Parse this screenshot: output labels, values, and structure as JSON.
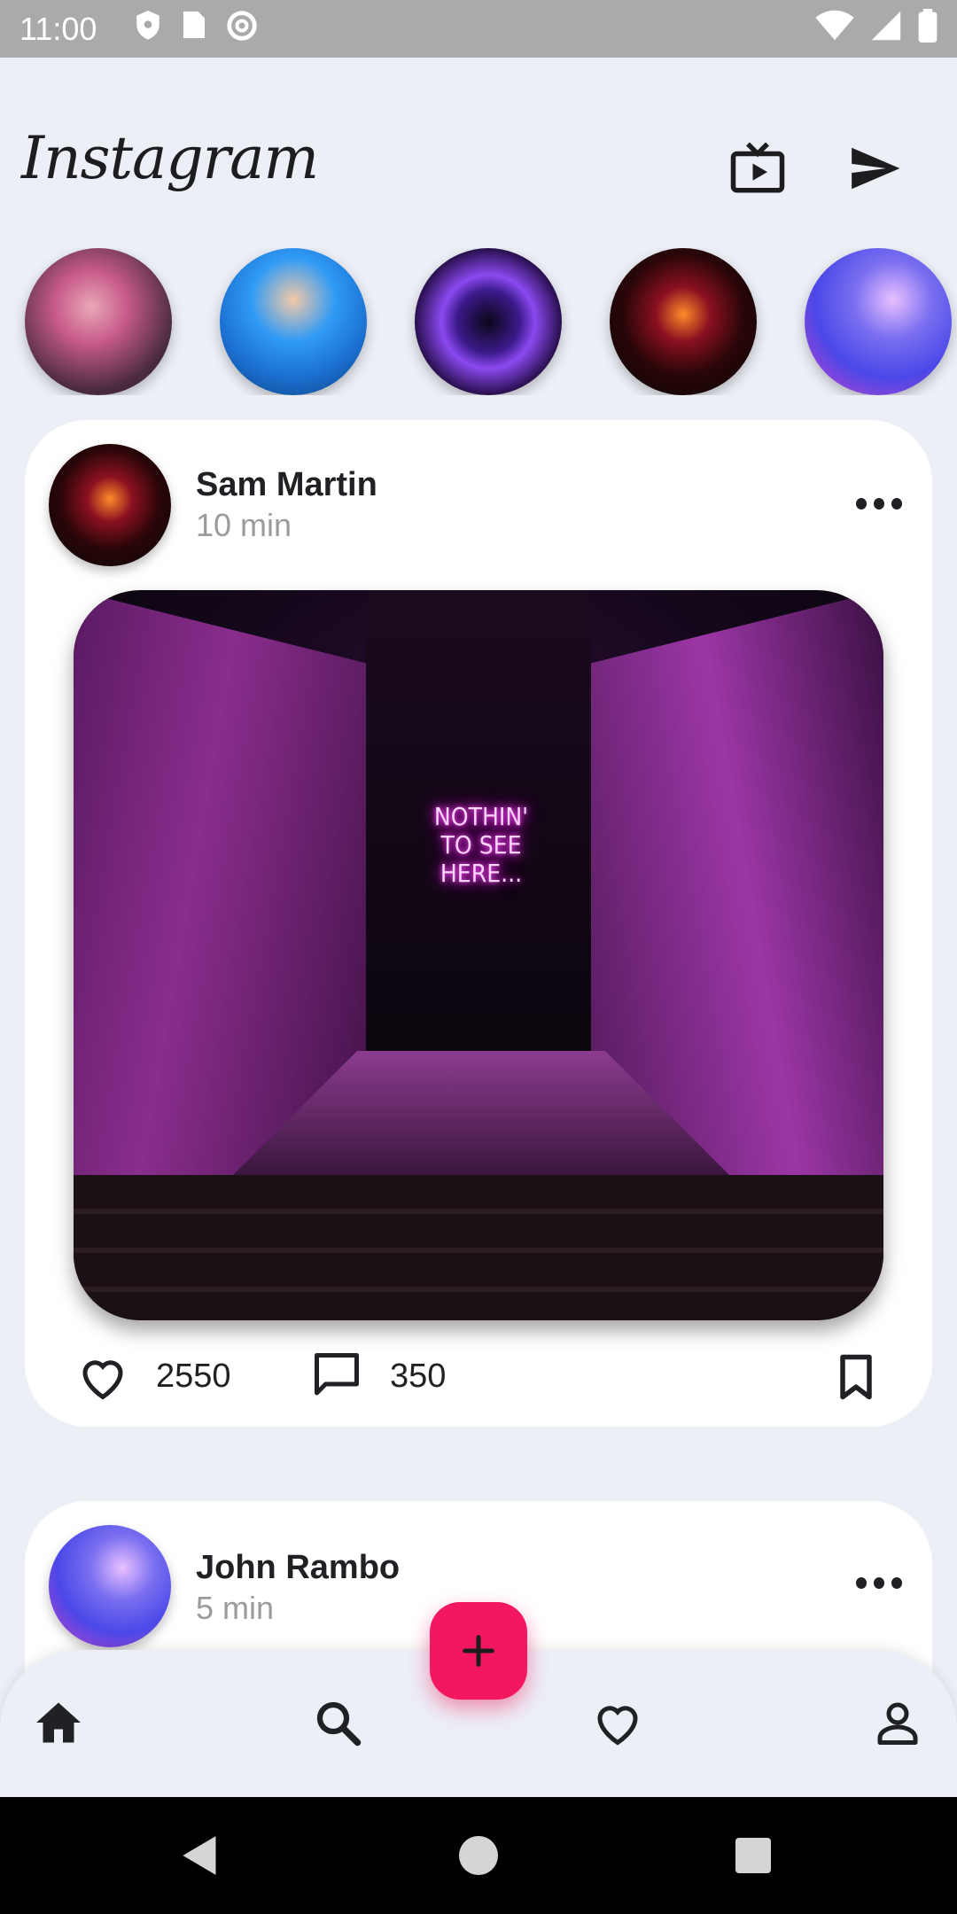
{
  "status_bar": {
    "time": "11:00",
    "left_icons": [
      "shield-icon",
      "sim-card-icon",
      "at-sign-icon"
    ],
    "right_icons": [
      "wifi-icon",
      "signal-icon",
      "battery-icon"
    ]
  },
  "header": {
    "logo": "Instagram",
    "icons": [
      "tv-icon",
      "send-icon"
    ]
  },
  "stories": [
    {
      "name": "story-1",
      "colors": [
        "#c85b8a",
        "#2b1f2a"
      ]
    },
    {
      "name": "story-2",
      "colors": [
        "#1e86e8",
        "#0c3f7a"
      ]
    },
    {
      "name": "story-3",
      "colors": [
        "#6a2fd6",
        "#120a2a"
      ]
    },
    {
      "name": "story-4",
      "colors": [
        "#8a1020",
        "#050505"
      ]
    },
    {
      "name": "story-5",
      "colors": [
        "#4a48e8",
        "#d040c8"
      ]
    }
  ],
  "posts": [
    {
      "user": "Sam Martin",
      "time": "10 min",
      "image_text": "NOTHIN' TO SEE HERE...",
      "likes": "2550",
      "comments": "350"
    },
    {
      "user": "John Rambo",
      "time": "5 min"
    }
  ],
  "bottom_nav": [
    "home-icon",
    "search-icon",
    "add-icon",
    "heart-icon",
    "profile-icon"
  ],
  "colors": {
    "background": "#eceff6",
    "fab": "#f2175e",
    "text": "#1d1d1f",
    "muted": "#9b9b9b"
  }
}
